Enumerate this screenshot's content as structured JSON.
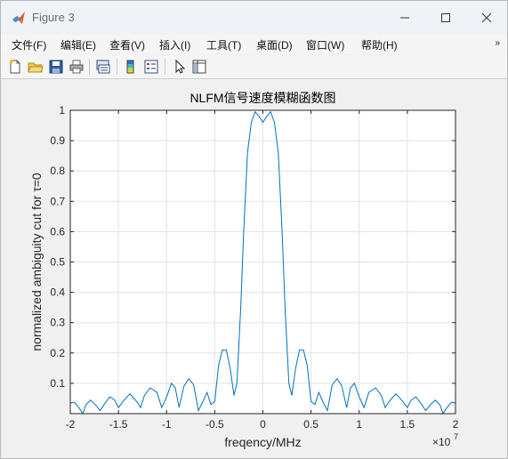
{
  "window": {
    "title": "Figure 3",
    "controls": {
      "minimize": "minimize-icon",
      "maximize": "maximize-icon",
      "close": "close-icon"
    }
  },
  "menu": {
    "items": [
      {
        "label": "文件(F)"
      },
      {
        "label": "编辑(E)"
      },
      {
        "label": "查看(V)"
      },
      {
        "label": "插入(I)"
      },
      {
        "label": "工具(T)"
      },
      {
        "label": "桌面(D)"
      },
      {
        "label": "窗口(W)"
      },
      {
        "label": "帮助(H)"
      }
    ],
    "overflow": "»"
  },
  "toolbar": {
    "icons": [
      "new-figure-icon",
      "open-file-icon",
      "save-icon",
      "print-icon",
      "link-plot-icon",
      "insert-colorbar-icon",
      "insert-legend-icon",
      "edit-plot-cursor-icon",
      "property-inspector-icon"
    ]
  },
  "chart_data": {
    "type": "line",
    "title": "NLFM信号速度模糊函数图",
    "xlabel": "freqency/MHz",
    "ylabel": "normalized ambiguity cut for τ=0",
    "x_exponent": "×10",
    "x_exponent_power": "7",
    "xlim": [
      -2,
      2
    ],
    "ylim": [
      0,
      1
    ],
    "xticks": [
      -2,
      -1.5,
      -1,
      -0.5,
      0,
      0.5,
      1,
      1.5,
      2
    ],
    "xtick_labels": [
      "-2",
      "-1.5",
      "-1",
      "-0.5",
      "0",
      "0.5",
      "1",
      "1.5",
      "2"
    ],
    "yticks": [
      0.1,
      0.2,
      0.3,
      0.4,
      0.5,
      0.6,
      0.7,
      0.8,
      0.9,
      1
    ],
    "ytick_labels": [
      "0.1",
      "0.2",
      "0.3",
      "0.4",
      "0.5",
      "0.6",
      "0.7",
      "0.8",
      "0.9",
      "1"
    ],
    "grid": true,
    "line_color": "#0072bd",
    "series": [
      {
        "x": [
          -2,
          -1.96,
          -1.91,
          -1.87,
          -1.84,
          -1.79,
          -1.74,
          -1.69,
          -1.65,
          -1.59,
          -1.54,
          -1.5,
          -1.44,
          -1.38,
          -1.31,
          -1.27,
          -1.23,
          -1.17,
          -1.1,
          -1.05,
          -1.0,
          -0.95,
          -0.91,
          -0.87,
          -0.82,
          -0.77,
          -0.72,
          -0.67,
          -0.63,
          -0.58,
          -0.54,
          -0.5,
          -0.46,
          -0.42,
          -0.38,
          -0.34,
          -0.3,
          -0.27,
          -0.23,
          -0.2,
          -0.16,
          -0.12,
          -0.08,
          -0.04,
          0,
          0.04,
          0.08,
          0.12,
          0.16,
          0.2,
          0.23,
          0.27,
          0.3,
          0.34,
          0.38,
          0.42,
          0.46,
          0.5,
          0.54,
          0.58,
          0.63,
          0.67,
          0.72,
          0.77,
          0.82,
          0.87,
          0.91,
          0.95,
          1.0,
          1.05,
          1.1,
          1.17,
          1.23,
          1.27,
          1.31,
          1.38,
          1.44,
          1.5,
          1.54,
          1.59,
          1.65,
          1.69,
          1.74,
          1.79,
          1.84,
          1.87,
          1.91,
          1.96,
          2
        ],
        "y": [
          0.035,
          0.038,
          0.02,
          0.0,
          0.028,
          0.045,
          0.03,
          0.01,
          0.03,
          0.055,
          0.045,
          0.02,
          0.045,
          0.065,
          0.04,
          0.02,
          0.06,
          0.085,
          0.07,
          0.02,
          0.055,
          0.1,
          0.085,
          0.02,
          0.09,
          0.115,
          0.095,
          0.01,
          0.035,
          0.07,
          0.03,
          0.04,
          0.16,
          0.21,
          0.21,
          0.15,
          0.06,
          0.1,
          0.35,
          0.6,
          0.86,
          0.96,
          0.995,
          0.98,
          0.96,
          0.98,
          0.995,
          0.96,
          0.86,
          0.6,
          0.35,
          0.1,
          0.06,
          0.15,
          0.21,
          0.21,
          0.16,
          0.04,
          0.03,
          0.07,
          0.035,
          0.01,
          0.095,
          0.115,
          0.09,
          0.02,
          0.085,
          0.1,
          0.055,
          0.02,
          0.07,
          0.085,
          0.06,
          0.02,
          0.04,
          0.065,
          0.045,
          0.02,
          0.045,
          0.055,
          0.03,
          0.01,
          0.03,
          0.045,
          0.028,
          0.0,
          0.02,
          0.038,
          0.035
        ]
      }
    ]
  }
}
